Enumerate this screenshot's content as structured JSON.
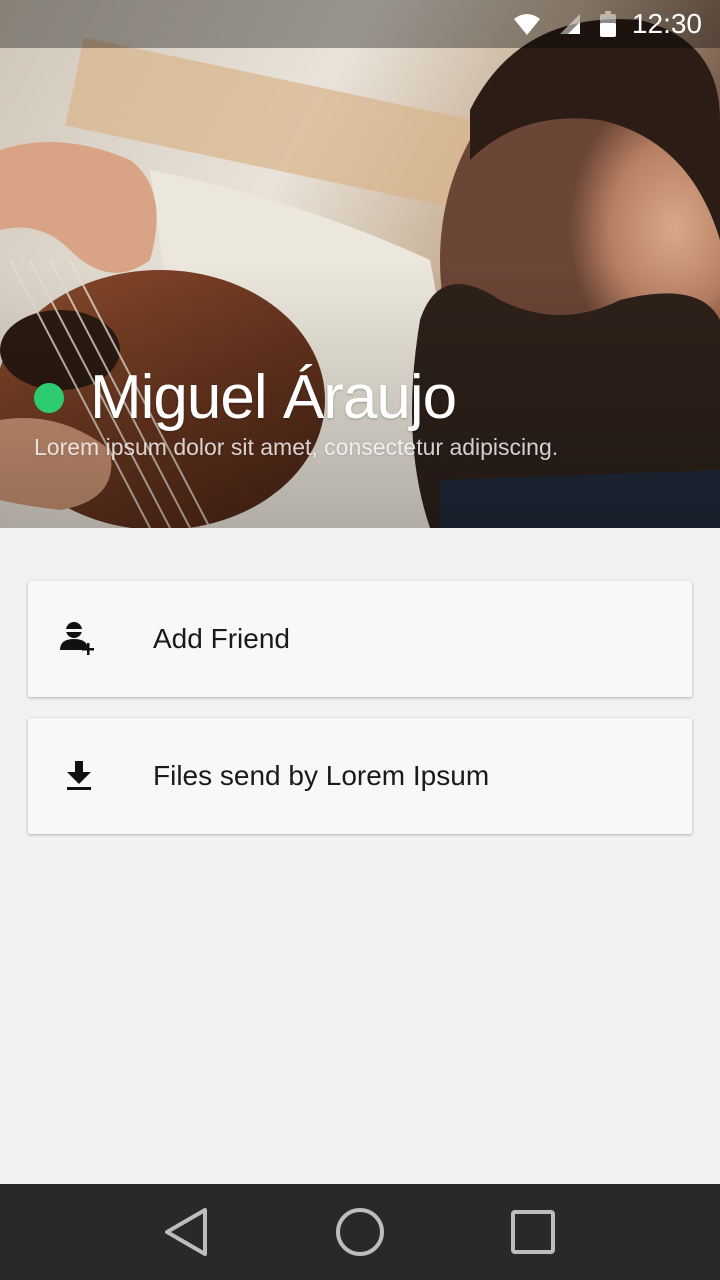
{
  "status_bar": {
    "time": "12:30",
    "icons": [
      "wifi-icon",
      "cell-signal-icon",
      "battery-icon"
    ]
  },
  "profile": {
    "name": "Miguel Áraujo",
    "status_text": "Lorem ipsum dolor sit amet, consectetur adipiscing.",
    "online": true,
    "online_color": "#2ecc71"
  },
  "actions": [
    {
      "label": "Add Friend",
      "icon": "add-person-icon"
    },
    {
      "label": "Files send by Lorem Ipsum",
      "icon": "download-icon"
    }
  ],
  "nav_bar": {
    "buttons": [
      "back-icon",
      "home-icon",
      "recents-icon"
    ]
  },
  "colors": {
    "background": "#f2f2f2",
    "card": "#f8f8f8",
    "nav_bar": "#292929"
  }
}
